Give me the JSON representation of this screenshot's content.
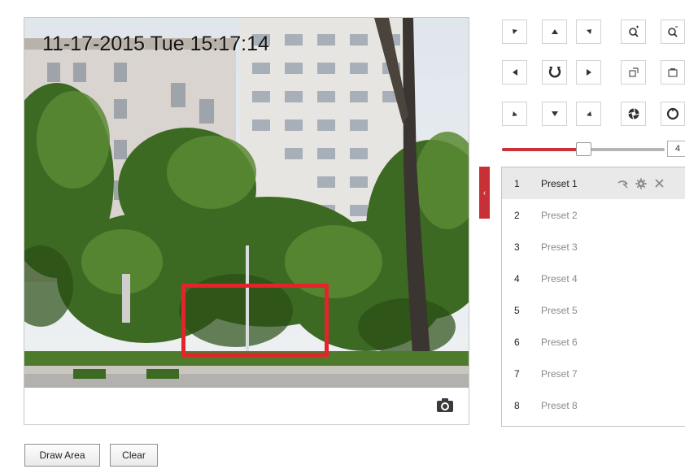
{
  "video": {
    "osd_time": "11-17-2015 Tue 15:17:14",
    "detection_color": "#e4232b",
    "snapshot_icon": "camera-icon"
  },
  "buttons": {
    "draw_area": "Draw Area",
    "clear": "Clear"
  },
  "ptz": {
    "controls": [
      {
        "name": "ptz-up-left-button",
        "icon": "arrow-up-left-icon"
      },
      {
        "name": "ptz-up-button",
        "icon": "arrow-up-icon"
      },
      {
        "name": "ptz-up-right-button",
        "icon": "arrow-up-right-icon"
      },
      {
        "name": "zoom-in-button",
        "icon": "zoom-in-icon"
      },
      {
        "name": "zoom-out-button",
        "icon": "zoom-out-icon"
      },
      {
        "name": "ptz-left-button",
        "icon": "arrow-left-icon"
      },
      {
        "name": "auto-pan-button",
        "icon": "auto-pan-icon"
      },
      {
        "name": "ptz-right-button",
        "icon": "arrow-right-icon"
      },
      {
        "name": "focus-near-button",
        "icon": "focus-near-icon"
      },
      {
        "name": "focus-far-button",
        "icon": "focus-far-icon"
      },
      {
        "name": "ptz-down-left-button",
        "icon": "arrow-down-left-icon"
      },
      {
        "name": "ptz-down-button",
        "icon": "arrow-down-icon"
      },
      {
        "name": "ptz-down-right-button",
        "icon": "arrow-down-right-icon"
      },
      {
        "name": "iris-open-button",
        "icon": "iris-open-icon"
      },
      {
        "name": "iris-close-button",
        "icon": "iris-close-icon"
      }
    ],
    "speed_label": "4",
    "speed_fraction": 0.5,
    "accent_color": "#c8303a"
  },
  "presets": {
    "collapse_glyph": "‹",
    "items": [
      {
        "num": "1",
        "name": "Preset 1",
        "selected": true
      },
      {
        "num": "2",
        "name": "Preset 2",
        "selected": false
      },
      {
        "num": "3",
        "name": "Preset 3",
        "selected": false
      },
      {
        "num": "4",
        "name": "Preset 4",
        "selected": false
      },
      {
        "num": "5",
        "name": "Preset 5",
        "selected": false
      },
      {
        "num": "6",
        "name": "Preset 6",
        "selected": false
      },
      {
        "num": "7",
        "name": "Preset 7",
        "selected": false
      },
      {
        "num": "8",
        "name": "Preset 8",
        "selected": false
      }
    ],
    "row_actions": [
      "call-preset-icon",
      "gear-icon",
      "close-icon"
    ]
  }
}
